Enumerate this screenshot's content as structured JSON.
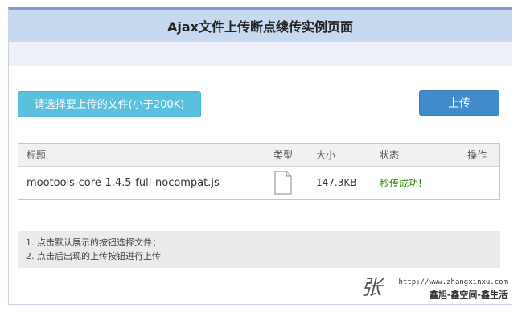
{
  "page": {
    "title": "Ajax文件上传断点续传实例页面"
  },
  "toolbar": {
    "select_label": "请选择要上传的文件(小于200K)",
    "upload_label": "上传"
  },
  "table": {
    "headers": [
      "标题",
      "类型",
      "大小",
      "状态",
      "操作"
    ],
    "rows": [
      {
        "name": "mootools-core-1.4.5-full-nocompat.js",
        "type_icon": "file-icon",
        "size": "147.3KB",
        "status": "秒传成功!",
        "action": ""
      }
    ]
  },
  "tips": [
    "1. 点击默认展示的按钮选择文件；",
    "2. 点击后出现的上传按钮进行上传"
  ],
  "watermark": {
    "sig": "张",
    "url": "http://www.zhangxinxu.com",
    "line": "鑫旭-鑫空间-鑫生活"
  },
  "colors": {
    "header_bg": "#c6d9ef",
    "select_btn": "#5bc0de",
    "upload_btn": "#428bca",
    "success": "#2a8a00"
  }
}
